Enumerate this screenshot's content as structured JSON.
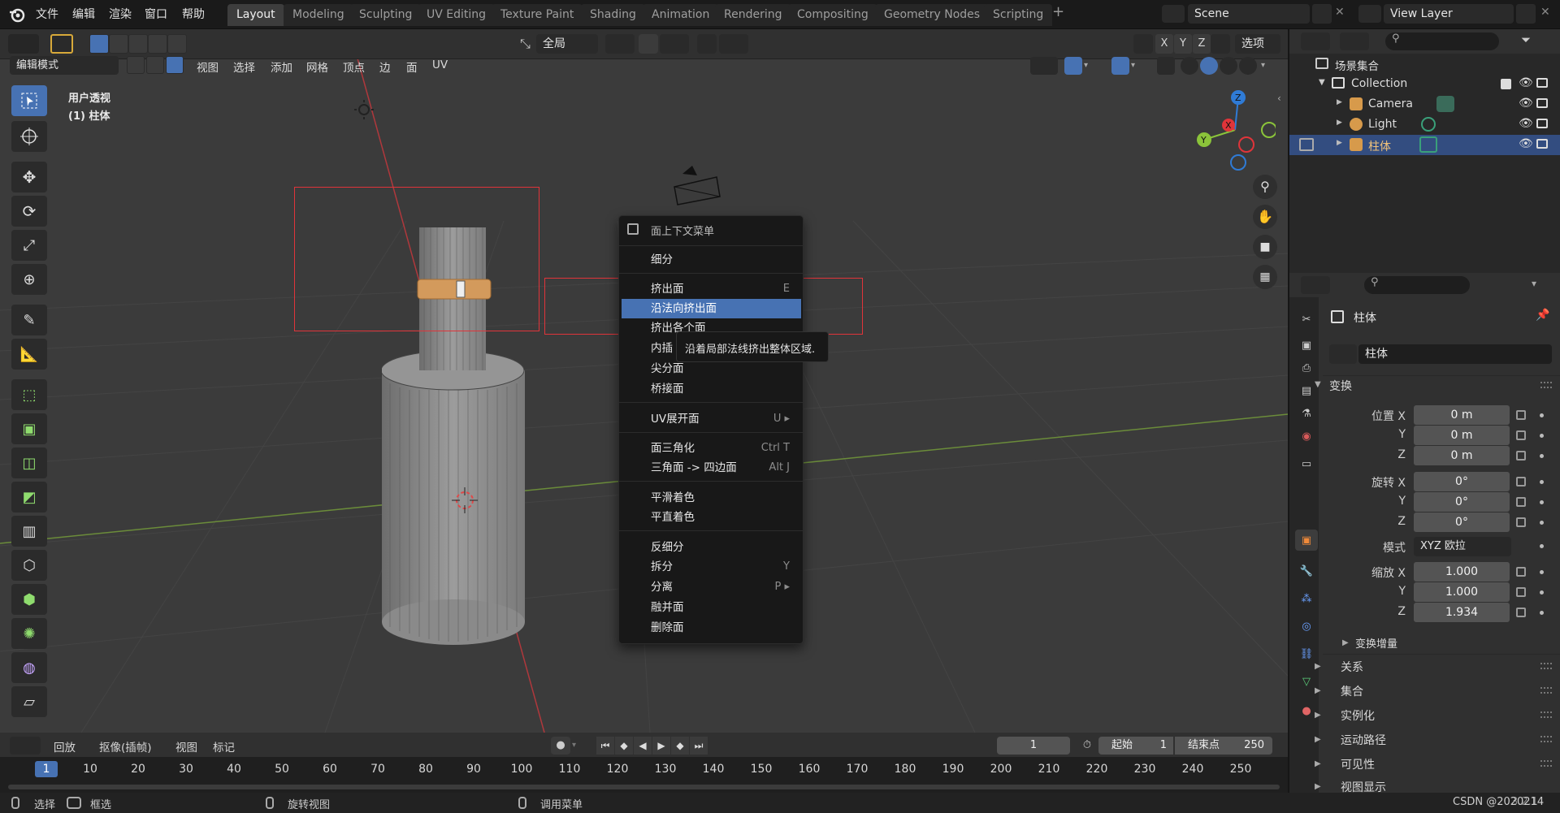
{
  "colors": {
    "accent": "#4772b3",
    "viewport": "#3b3b3b",
    "selection_box": "#e0343a",
    "gizmo_x": "#e0343a",
    "gizmo_y": "#8bc43a",
    "gizmo_z": "#2f7bd6"
  },
  "top_menu": {
    "file": "文件",
    "edit": "编辑",
    "render": "渲染",
    "window": "窗口",
    "help": "帮助"
  },
  "workspace_tabs": [
    "Layout",
    "Modeling",
    "Sculpting",
    "UV Editing",
    "Texture Paint",
    "Shading",
    "Animation",
    "Rendering",
    "Compositing",
    "Geometry Nodes",
    "Scripting"
  ],
  "add_tab": "+",
  "scene": {
    "name": "Scene",
    "view_layer": "View Layer"
  },
  "header2": {
    "transform_orient": "全局",
    "axes": [
      "X",
      "Y",
      "Z"
    ],
    "options": "选项"
  },
  "editor_header": {
    "mode": "编辑模式",
    "menus": [
      "视图",
      "选择",
      "添加",
      "网格",
      "顶点",
      "边",
      "面",
      "UV"
    ]
  },
  "viewport": {
    "view_name": "用户透视",
    "object_name": "(1) 柱体"
  },
  "gizmo": {
    "x": "X",
    "y": "Y",
    "z": "Z"
  },
  "context_menu": {
    "title": "面上下文菜单",
    "items": [
      {
        "label": "细分",
        "shortcut": ""
      },
      {
        "label": "挤出面",
        "shortcut": "E"
      },
      {
        "label": "沿法向挤出面",
        "shortcut": ""
      },
      {
        "label": "挤出各个面",
        "shortcut": ""
      },
      {
        "label": "内插",
        "shortcut": ""
      },
      {
        "label": "尖分面",
        "shortcut": ""
      },
      {
        "label": "桥接面",
        "shortcut": ""
      },
      {
        "label": "UV展开面",
        "shortcut": "U ▸"
      },
      {
        "label": "面三角化",
        "shortcut": "Ctrl T"
      },
      {
        "label": "三角面 -> 四边面",
        "shortcut": "Alt J"
      },
      {
        "label": "平滑着色",
        "shortcut": ""
      },
      {
        "label": "平直着色",
        "shortcut": ""
      },
      {
        "label": "反细分",
        "shortcut": ""
      },
      {
        "label": "拆分",
        "shortcut": "Y"
      },
      {
        "label": "分离",
        "shortcut": "P ▸"
      },
      {
        "label": "融并面",
        "shortcut": ""
      },
      {
        "label": "删除面",
        "shortcut": ""
      }
    ],
    "tooltip": "沿着局部法线挤出整体区域."
  },
  "outliner": {
    "root": "场景集合",
    "collection": "Collection",
    "rows": [
      {
        "name": "Camera"
      },
      {
        "name": "Light"
      },
      {
        "name": "柱体"
      }
    ]
  },
  "properties": {
    "object_title": "柱体",
    "object_name_field": "柱体",
    "transform_panel": "变换",
    "location_label": "位置 X",
    "loc": [
      "0 m",
      "0 m",
      "0 m"
    ],
    "rotation_label": "旋转 X",
    "rot": [
      "0°",
      "0°",
      "0°"
    ],
    "axis_y": "Y",
    "axis_z": "Z",
    "mode_label": "模式",
    "rotation_mode": "XYZ 欧拉",
    "scale_label": "缩放 X",
    "scale": [
      "1.000",
      "1.000",
      "1.934"
    ],
    "delta_transform": "变换增量",
    "panels": [
      "关系",
      "集合",
      "实例化",
      "运动路径",
      "可见性",
      "视图显示"
    ]
  },
  "timeline": {
    "playback": "回放",
    "keying": "抠像(插帧)",
    "view": "视图",
    "marker": "标记",
    "current_frame": "1",
    "start_label": "起始",
    "start": "1",
    "end_label": "结束点",
    "end": "250",
    "ticks": [
      "1",
      "10",
      "20",
      "30",
      "40",
      "50",
      "60",
      "70",
      "80",
      "90",
      "100",
      "110",
      "120",
      "130",
      "140",
      "150",
      "160",
      "170",
      "180",
      "190",
      "200",
      "210",
      "220",
      "230",
      "240",
      "250"
    ]
  },
  "status_bar": {
    "select": "选择",
    "box_select": "框选",
    "rotate_view": "旋转视图",
    "call_menu": "调用菜单",
    "version": "3.2.1",
    "watermark": "CSDN @2020214"
  }
}
